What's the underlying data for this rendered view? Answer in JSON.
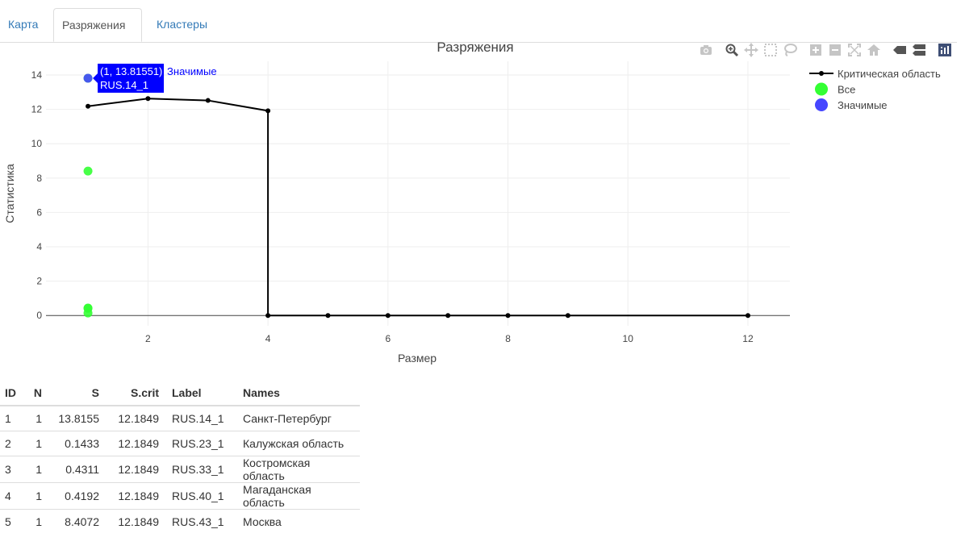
{
  "tabs": [
    {
      "label": "Карта",
      "active": false
    },
    {
      "label": "Разряжения",
      "active": true
    },
    {
      "label": "Кластеры",
      "active": false
    }
  ],
  "modebar_icons": [
    "camera-icon",
    "zoom-icon",
    "pan-icon",
    "box-select-icon",
    "lasso-select-icon",
    "zoom-in-icon",
    "zoom-out-icon",
    "autoscale-icon",
    "home-icon",
    "hover-closest-icon",
    "hover-compare-icon",
    "plotly-logo-icon"
  ],
  "chart_data": {
    "type": "line",
    "title": "Разряжения",
    "xlabel": "Размер",
    "ylabel": "Статистика",
    "xlim": [
      0.3,
      12.7
    ],
    "ylim": [
      -0.6,
      14.8
    ],
    "xticks": [
      2,
      4,
      6,
      8,
      10,
      12
    ],
    "yticks": [
      0,
      2,
      4,
      6,
      8,
      10,
      12,
      14
    ],
    "grid": true,
    "legend_position": "top-right",
    "series": [
      {
        "name": "Критическая область",
        "mode": "lines+markers",
        "color": "#000000",
        "x": [
          1,
          2,
          3,
          4,
          4,
          5,
          6,
          7,
          8,
          9,
          12
        ],
        "y": [
          12.1849,
          12.63,
          12.52,
          11.92,
          0,
          0,
          0,
          0,
          0,
          0,
          0
        ]
      },
      {
        "name": "Все",
        "mode": "markers",
        "color": "#33ff33",
        "x": [
          1,
          1,
          1,
          1,
          1
        ],
        "y": [
          13.8155,
          0.1433,
          0.4311,
          0.4192,
          8.4072
        ]
      },
      {
        "name": "Значимые",
        "mode": "markers",
        "color": "#4646ff",
        "x": [
          1
        ],
        "y": [
          13.8155
        ]
      }
    ],
    "hover": {
      "x": 1,
      "y": 13.8155,
      "line1": "(1, 13.81551)",
      "line2": "RUS.14_1",
      "series": "Значимые",
      "bg": "#0000ff"
    }
  },
  "table": {
    "headers": [
      "ID",
      "N",
      "S",
      "S.crit",
      "Label",
      "Names"
    ],
    "rows": [
      [
        "1",
        "1",
        "13.8155",
        "12.1849",
        "RUS.14_1",
        "Санкт-Петербург"
      ],
      [
        "2",
        "1",
        "0.1433",
        "12.1849",
        "RUS.23_1",
        "Калужская область"
      ],
      [
        "3",
        "1",
        "0.4311",
        "12.1849",
        "RUS.33_1",
        "Костромская область"
      ],
      [
        "4",
        "1",
        "0.4192",
        "12.1849",
        "RUS.40_1",
        "Магаданская область"
      ],
      [
        "5",
        "1",
        "8.4072",
        "12.1849",
        "RUS.43_1",
        "Москва"
      ]
    ]
  }
}
